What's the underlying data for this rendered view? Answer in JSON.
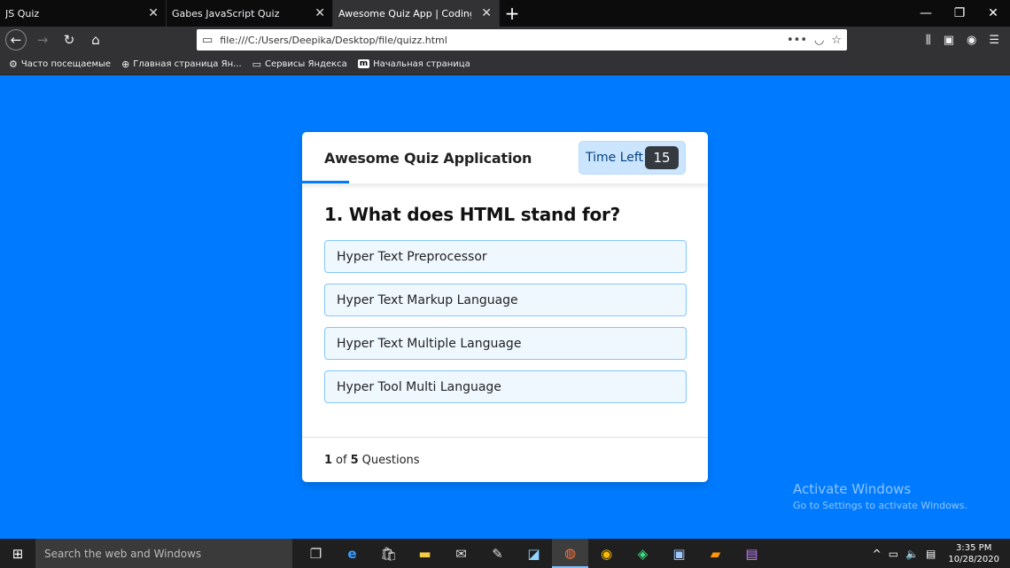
{
  "browser": {
    "tabs": [
      {
        "title": "JS Quiz",
        "active": false
      },
      {
        "title": "Gabes JavaScript Quiz",
        "active": false
      },
      {
        "title": "Awesome Quiz App | CodingNepal",
        "active": true
      }
    ],
    "url": "file:///C:/Users/Deepika/Desktop/file/quizz.html",
    "bookmarks": [
      {
        "label": "Часто посещаемые",
        "icon": "gear-icon"
      },
      {
        "label": "Главная страница Ян...",
        "icon": "globe-icon"
      },
      {
        "label": "Сервисы Яндекса",
        "icon": "folder-icon"
      },
      {
        "label": "Начальная страница",
        "icon": "m-logo-icon"
      }
    ]
  },
  "quiz": {
    "title": "Awesome Quiz Application",
    "timer_label": "Time Left",
    "timer_seconds": "15",
    "question_number": "1.",
    "question_text": "What does HTML stand for?",
    "options": [
      "Hyper Text Preprocessor",
      "Hyper Text Markup Language",
      "Hyper Text Multiple Language",
      "Hyper Tool Multi Language"
    ],
    "footer": {
      "current": "1",
      "of": "of",
      "total": "5",
      "suffix": "Questions"
    },
    "accent_color": "#007bff"
  },
  "watermark": {
    "title": "Activate Windows",
    "subtitle": "Go to Settings to activate Windows."
  },
  "taskbar": {
    "search_placeholder": "Search the web and Windows",
    "time": "3:35 PM",
    "date": "10/28/2020"
  }
}
